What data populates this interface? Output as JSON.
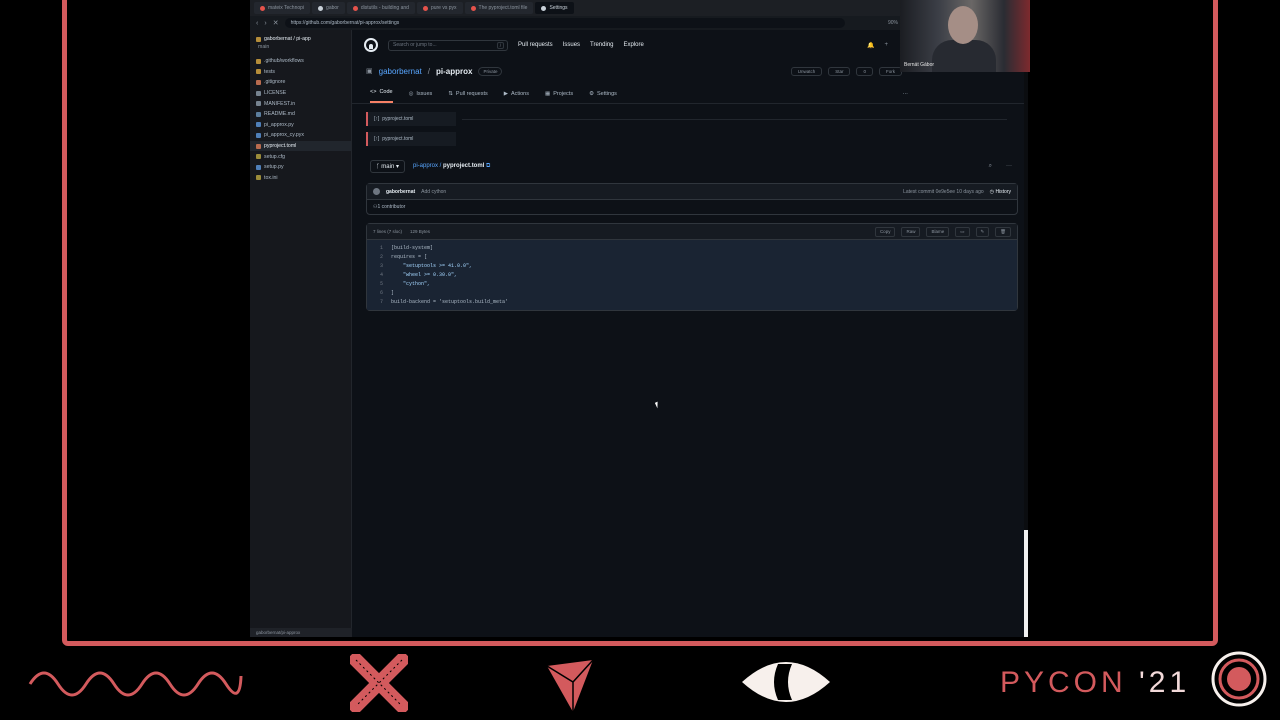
{
  "browser": {
    "tabs": [
      {
        "label": "mateix Technopi",
        "active": false
      },
      {
        "label": "gabor",
        "active": false
      },
      {
        "label": "distutils - building and",
        "active": false
      },
      {
        "label": "pure vs pyx",
        "active": false
      },
      {
        "label": "The pyproject.toml file",
        "active": false
      },
      {
        "label": "Settings",
        "active": true
      }
    ],
    "url": "https://github.com/gaborbernat/pi-approx/settings",
    "zoom": "90%"
  },
  "sidebar": {
    "title": "gaborbernat / pi-app",
    "branch": "main",
    "items": [
      {
        "label": ".github/workflows",
        "icon": "folder"
      },
      {
        "label": "tests",
        "icon": "folder"
      },
      {
        "label": ".gitignore",
        "icon": "git"
      },
      {
        "label": "LICENSE",
        "icon": "file"
      },
      {
        "label": "MANIFEST.in",
        "icon": "file"
      },
      {
        "label": "README.md",
        "icon": "md"
      },
      {
        "label": "pi_approx.py",
        "icon": "py"
      },
      {
        "label": "pi_approx_cy.pyx",
        "icon": "py"
      },
      {
        "label": "pyproject.toml",
        "icon": "toml",
        "active": true
      },
      {
        "label": "setup.cfg",
        "icon": "cfg"
      },
      {
        "label": "setup.py",
        "icon": "py"
      },
      {
        "label": "tox.ini",
        "icon": "cfg"
      }
    ],
    "status": "gaborbernat/pi-approx"
  },
  "github": {
    "search_placeholder": "Search or jump to...",
    "search_key": "/",
    "nav": [
      "Pull requests",
      "Issues",
      "Trending",
      "Explore"
    ],
    "repo_owner": "gaborbernat",
    "repo_name": "pi-approx",
    "repo_visibility": "Private",
    "actions": [
      "Unwatch",
      "Star",
      "0",
      "Fork"
    ],
    "tabs": [
      "Code",
      "Issues",
      "Pull requests",
      "Actions",
      "Projects",
      "Settings"
    ],
    "selected_tab": "Code",
    "notes": [
      "pyproject.toml",
      "pyproject.toml"
    ],
    "branch": "main",
    "breadcrumb_repo": "pi-approx",
    "breadcrumb_file": "pyproject.toml",
    "commit_user": "gaborbernat",
    "commit_msg": "Add cython",
    "commit_meta": "Latest commit 0e9e5ee 10 days ago",
    "history": "History",
    "contributors": "1 contributor",
    "file_info_lines": "7 lines (7 sloc)",
    "file_info_size": "129 Bytes",
    "code_buttons": [
      "Copy",
      "Raw",
      "Blame"
    ],
    "code_lines": [
      "[build-system]",
      "requires = [",
      "    \"setuptools >= 41.0.0\",",
      "    \"wheel >= 0.30.0\",",
      "    \"cython\",",
      "]",
      "build-backend = 'setuptools.build_meta'"
    ]
  },
  "webcam": {
    "label": "Bernát Gábor"
  },
  "footer": {
    "brand": "PYCON",
    "year": "'21"
  },
  "colors": {
    "accent": "#d35a5d",
    "bg": "#000000"
  }
}
